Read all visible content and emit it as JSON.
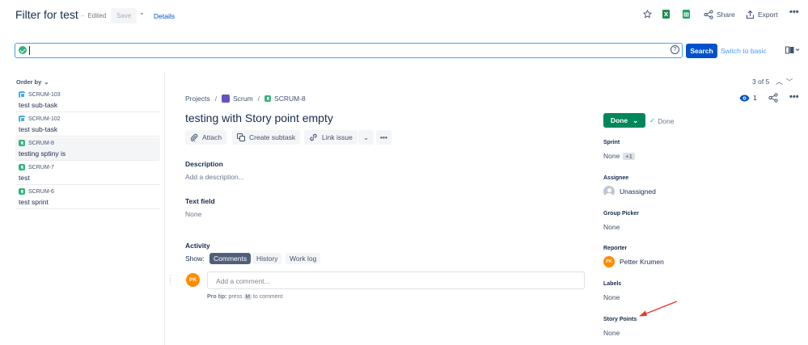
{
  "header": {
    "title": "Filter for test",
    "edited": "Edited",
    "save_label": "Save",
    "details_label": "Details",
    "share_label": "Share",
    "export_label": "Export"
  },
  "search": {
    "query": "",
    "button_label": "Search",
    "switch_label": "Switch to basic"
  },
  "list": {
    "order_by_label": "Order by",
    "items": [
      {
        "key": "SCRUM-103",
        "summary": "test sub-task",
        "type": "subtask",
        "selected": false
      },
      {
        "key": "SCRUM-102",
        "summary": "test sub-task",
        "type": "subtask",
        "selected": false
      },
      {
        "key": "SCRUM-8",
        "summary": "testing sptiny is",
        "type": "story",
        "selected": true
      },
      {
        "key": "SCRUM-7",
        "summary": "test",
        "type": "story",
        "selected": false
      },
      {
        "key": "SCRUM-6",
        "summary": "test sprint",
        "type": "story",
        "selected": false
      }
    ]
  },
  "breadcrumb": {
    "projects": "Projects",
    "project": "Scrum",
    "issue_key": "SCRUM-8"
  },
  "issue": {
    "title": "testing with Story point empty",
    "actions": {
      "attach": "Attach",
      "create_subtask": "Create subtask",
      "link_issue": "Link issue"
    },
    "description_label": "Description",
    "description_placeholder": "Add a description...",
    "text_field_label": "Text field",
    "text_field_value": "None"
  },
  "activity": {
    "label": "Activity",
    "show_label": "Show:",
    "tabs": [
      "Comments",
      "History",
      "Work log"
    ],
    "active_tab": "Comments",
    "comment_placeholder": "Add a comment...",
    "user_initials": "PK",
    "pro_tip_prefix": "Pro tip:",
    "pro_tip_press": "press",
    "pro_tip_key": "M",
    "pro_tip_suffix": "to comment"
  },
  "pager": {
    "text": "3 of 5"
  },
  "watchers": {
    "count": "1"
  },
  "status": {
    "button_label": "Done",
    "resolution": "Done"
  },
  "fields": {
    "sprint_label": "Sprint",
    "sprint_value": "None",
    "sprint_extra": "+1",
    "assignee_label": "Assignee",
    "assignee_value": "Unassigned",
    "group_picker_label": "Group Picker",
    "group_picker_value": "None",
    "reporter_label": "Reporter",
    "reporter_initials": "PK",
    "reporter_value": "Petter Krumen",
    "labels_label": "Labels",
    "labels_value": "None",
    "story_points_label": "Story Points",
    "story_points_value": "None"
  },
  "colors": {
    "primary": "#0052cc",
    "success": "#00875a",
    "annotation_arrow": "#e5392a",
    "avatar": "#ff8b00"
  }
}
